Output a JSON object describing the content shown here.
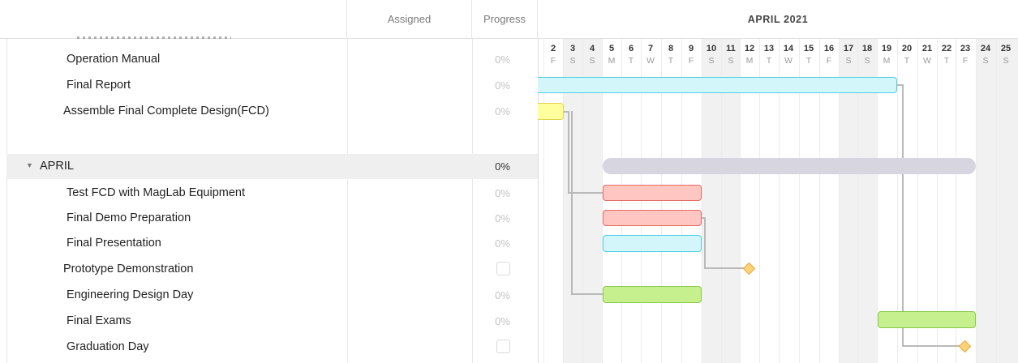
{
  "header": {
    "assigned_label": "Assigned",
    "progress_label": "Progress",
    "month_label": "APRIL 2021"
  },
  "days": [
    {
      "n": "2",
      "l": "F"
    },
    {
      "n": "3",
      "l": "S"
    },
    {
      "n": "4",
      "l": "S"
    },
    {
      "n": "5",
      "l": "M"
    },
    {
      "n": "6",
      "l": "T"
    },
    {
      "n": "7",
      "l": "W"
    },
    {
      "n": "8",
      "l": "T"
    },
    {
      "n": "9",
      "l": "F"
    },
    {
      "n": "10",
      "l": "S"
    },
    {
      "n": "11",
      "l": "S"
    },
    {
      "n": "12",
      "l": "M"
    },
    {
      "n": "13",
      "l": "T"
    },
    {
      "n": "14",
      "l": "W"
    },
    {
      "n": "15",
      "l": "T"
    },
    {
      "n": "16",
      "l": "F"
    },
    {
      "n": "17",
      "l": "S"
    },
    {
      "n": "18",
      "l": "S"
    },
    {
      "n": "19",
      "l": "M"
    },
    {
      "n": "20",
      "l": "T"
    },
    {
      "n": "21",
      "l": "W"
    },
    {
      "n": "22",
      "l": "T"
    },
    {
      "n": "23",
      "l": "F"
    },
    {
      "n": "24",
      "l": "S"
    },
    {
      "n": "25",
      "l": "S"
    }
  ],
  "tasks": [
    {
      "name": "Operation Manual",
      "progress": "0%"
    },
    {
      "name": "Final Report",
      "progress": "0%"
    },
    {
      "name": "Assemble Final Complete Design(FCD)",
      "progress": "0%"
    },
    {
      "name": "APRIL",
      "progress": "0%"
    },
    {
      "name": "Test FCD with MagLab Equipment",
      "progress": "0%"
    },
    {
      "name": "Final Demo Preparation",
      "progress": "0%"
    },
    {
      "name": "Final Presentation",
      "progress": "0%"
    },
    {
      "name": "Prototype Demonstration",
      "progress": ""
    },
    {
      "name": "Engineering Design Day",
      "progress": "0%"
    },
    {
      "name": "Final Exams",
      "progress": "0%"
    },
    {
      "name": "Graduation Day",
      "progress": ""
    }
  ],
  "group_caret": "▼",
  "colors": {
    "cyan": "#d3f6fb",
    "cyan_border": "#4fd0e3",
    "yellow": "#ffff9e",
    "yellow_border": "#e6d24f",
    "red": "#ffc6c2",
    "red_border": "#e36b63",
    "green": "#c6ef8e",
    "green_border": "#8cc94e",
    "group": "#d6d5e0",
    "milestone": "#ffd27a"
  }
}
